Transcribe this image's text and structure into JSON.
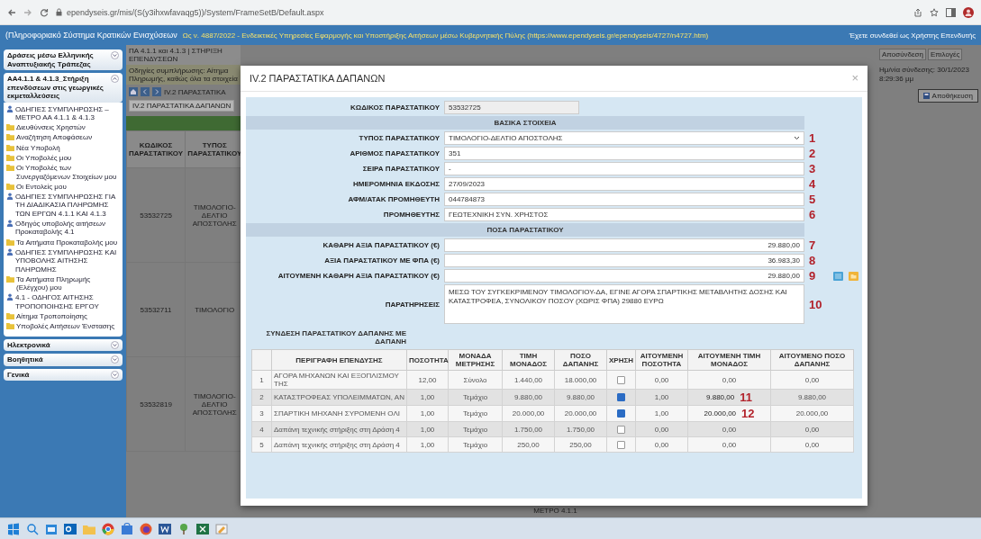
{
  "browser": {
    "url": "ependyseis.gr/mis/(S(y3ihxwfavaqg5))/System/FrameSetB/Default.aspx"
  },
  "header": {
    "title": "(Πληροφοριακό Σύστημα Κρατικών Ενισχύσεων",
    "notice": "Ως ν. 4887/2022 - Ενδεικτικές Υπηρεσίες Εφαρμογής και Υποστήριξης Αιτήσεων μέσω Κυβερνητικής Πύλης (https://www.ependyseis.gr/ependyseis/4727/n4727.htm)",
    "user_info": "Έχετε συνδεθεί ως Χρήστης Επενδυτής"
  },
  "sidebar": {
    "sections": [
      {
        "title": "Δράσεις μέσω Ελληνικής Αναπτυξιακής Τράπεζας",
        "expanded": false
      },
      {
        "title": "ΑΑ4.1.1 & 4.1.3_Στήριξη επενδύσεων στις γεωργικές εκμεταλλεύσεις",
        "expanded": true,
        "items": [
          {
            "kind": "guide",
            "label": "ΟΔΗΓΙΕΣ ΣΥΜΠΛΗΡΩΣΗΣ – ΜΕΤΡΟ ΑΑ 4.1.1 & 4.1.3"
          },
          {
            "kind": "folder",
            "label": "Διευθύνσεις Χρηστών"
          },
          {
            "kind": "folder",
            "label": "Αναζήτηση Αποφάσεων"
          },
          {
            "kind": "folder",
            "label": "Νέα Υποβολή"
          },
          {
            "kind": "folder",
            "label": "Οι Υποβολές μου"
          },
          {
            "kind": "folder",
            "label": "Οι Υποβολές των Συνεργαζόμενων Στοιχείων μου"
          },
          {
            "kind": "folder",
            "label": "Οι Εντολείς μου"
          },
          {
            "kind": "guide",
            "label": "ΟΔΗΓΙΕΣ ΣΥΜΠΛΗΡΩΣΗΣ ΓΙΑ ΤΗ ΔΙΑΔΙΚΑΣΙΑ ΠΛΗΡΩΜΗΣ ΤΩΝ ΕΡΓΩΝ 4.1.1 ΚΑΙ 4.1.3"
          },
          {
            "kind": "guide",
            "label": "Οδηγός υποβολής αιτήσεων Προκαταβολής 4.1"
          },
          {
            "kind": "folder",
            "label": "Τα Αιτήματα Προκαταβολής μου"
          },
          {
            "kind": "guide",
            "label": "ΟΔΗΓΙΕΣ ΣΥΜΠΛΗΡΩΣΗΣ ΚΑΙ ΥΠΟΒΟΛΗΣ ΑΙΤΗΣΗΣ ΠΛΗΡΩΜΗΣ"
          },
          {
            "kind": "folder",
            "label": "Τα Αιτήματα Πληρωμής (Ελέγχου) μου"
          },
          {
            "kind": "guide",
            "label": "4.1 - ΟΔΗΓΟΣ ΑΙΤΗΣΗΣ ΤΡΟΠΟΠΟΙΗΣΗΣ ΕΡΓΟΥ"
          },
          {
            "kind": "folder",
            "label": "Αίτημα Τροποποίησης"
          },
          {
            "kind": "folder",
            "label": "Υποβολές Αιτήσεων Ένστασης"
          }
        ]
      },
      {
        "title": "Ηλεκτρονικά",
        "expanded": false
      },
      {
        "title": "Βοηθητικά",
        "expanded": false
      },
      {
        "title": "Γενικά",
        "expanded": false
      }
    ]
  },
  "page": {
    "breadcrumb": "ΠΑ 4.1.1 και 4.1.3 | ΣΤΗΡΙΞΗ ΕΠΕΝΔΥΣΕΩΝ",
    "info": "Οδηγίες συμπλήρωσης: Αίτημα Πληρωμής, καθώς όλα τα στοιχεία",
    "tab": "IV.2 ΠΑΡΑΣΤΑΤΙΚΑ ΔΑΠΑΝΩΝ",
    "toolbar_title": "IV.2 ΠΑΡΑΣΤΑΤΙΚΑ",
    "columns": [
      "ΚΩΔΙΚΟΣ ΠΑΡΑΣΤΑΤΙΚΟΥ",
      "ΤΥΠΟΣ ΠΑΡΑΣΤΑΤΙΚΟΥ"
    ],
    "rows": [
      [
        "53532725",
        "ΤΙΜΟΛΟΓΙΟ-ΔΕΛΤΙΟ ΑΠΟΣΤΟΛΗΣ"
      ],
      [
        "53532711",
        "ΤΙΜΟΛΟΓΙΟ"
      ],
      [
        "53532819",
        "ΤΙΜΟΛΟΓΙΟ-ΔΕΛΤΙΟ ΑΠΟΣΤΟΛΗΣ"
      ]
    ],
    "top_buttons": [
      "Αποσύνδεση",
      "Επιλογές"
    ],
    "session": "Ημ/νία σύνδεσης: 30/1/2023 8:29:36 μμ",
    "save_button": "Αποθήκευση",
    "footer": "ΜΕΤΡΟ 4.1.1"
  },
  "modal": {
    "title": "IV.2 ΠΑΡΑΣΤΑΤΙΚΑ ΔΑΠΑΝΩΝ",
    "close": "×",
    "form": [
      {
        "kind": "readonly",
        "label": "ΚΩΔΙΚΟΣ ΠΑΡΑΣΤΑΤΙΚΟΥ",
        "value": "53532725"
      },
      {
        "kind": "section",
        "label": "ΒΑΣΙΚΑ ΣΤΟΙΧΕΙΑ"
      },
      {
        "kind": "select",
        "label": "ΤΥΠΟΣ ΠΑΡΑΣΤΑΤΙΚΟΥ",
        "value": "ΤΙΜΟΛΟΓΙΟ-ΔΕΛΤΙΟ ΑΠΟΣΤΟΛΗΣ",
        "annotation": "1"
      },
      {
        "kind": "text",
        "label": "ΑΡΙΘΜΟΣ ΠΑΡΑΣΤΑΤΙΚΟΥ",
        "value": "351",
        "annotation": "2"
      },
      {
        "kind": "text",
        "label": "ΣΕΙΡΑ ΠΑΡΑΣΤΑΤΙΚΟΥ",
        "value": "-",
        "annotation": "3"
      },
      {
        "kind": "text",
        "label": "ΗΜΕΡΟΜΗΝΙΑ ΕΚΔΟΣΗΣ",
        "value": "27/09/2023",
        "annotation": "4"
      },
      {
        "kind": "text",
        "label": "ΑΦΜ/ΑΤΑΚ ΠΡΟΜΗΘΕΥΤΗ",
        "value": "044784873",
        "annotation": "5"
      },
      {
        "kind": "text",
        "label": "ΠΡΟΜΗΘΕΥΤΗΣ",
        "value": "ΓΕΩΤΕΧΝΙΚΗ ΣΥΝ. ΧΡΗΣΤΟΣ",
        "annotation": "6"
      },
      {
        "kind": "section",
        "label": "ΠΟΣΑ ΠΑΡΑΣΤΑΤΙΚΟΥ"
      },
      {
        "kind": "amount",
        "label": "ΚΑΘΑΡΗ ΑΞΙΑ ΠΑΡΑΣΤΑΤΙΚΟΥ (€)",
        "value": "29.880,00",
        "annotation": "7"
      },
      {
        "kind": "amount",
        "label": "ΑΞΙΑ ΠΑΡΑΣΤΑΤΙΚΟΥ ΜΕ ΦΠΑ (€)",
        "value": "36.983,30",
        "annotation": "8"
      },
      {
        "kind": "amount",
        "label": "ΑΙΤΟΥΜΕΝΗ ΚΑΘΑΡΗ ΑΞΙΑ ΠΑΡΑΣΤΑΤΙΚΟΥ (€)",
        "value": "29.880,00",
        "annotation": "9",
        "tools": true
      },
      {
        "kind": "textarea",
        "label": "ΠΑΡΑΤΗΡΗΣΕΙΣ",
        "value": "ΜΕΣΩ ΤΟΥ ΣΥΓΚΕΚΡΙΜΕΝΟΥ ΤΙΜΟΛΟΓΙΟΥ-ΔΑ, ΕΓΙΝΕ ΑΓΟΡΑ ΣΠΑΡΤΙΚΗΣ ΜΕΤΑΒΛΗΤΗΣ ΔΟΣΗΣ ΚΑΙ ΚΑΤΑΣΤΡΟΦΕΑ, ΣΥΝΟΛΙΚΟΥ ΠΟΣΟΥ (ΧΩΡΙΣ ΦΠΑ) 29880 ΕΥΡΩ",
        "annotation": "10"
      }
    ],
    "table_title": "ΣΥΝΔΕΣΗ ΠΑΡΑΣΤΑΤΙΚΟΥ ΔΑΠΑΝΗΣ ΜΕ ΔΑΠΑΝΗ",
    "columns": [
      {
        "label": "ΠΕΡΙΓΡΑΦΗ ΕΠΕΝΔΥΣΗΣ",
        "kind": "text"
      },
      {
        "label": "ΠΟΣΟΤΗΤΑ",
        "kind": "text"
      },
      {
        "label": "ΜΟΝΑΔΑ ΜΕΤΡΗΣΗΣ",
        "kind": "text"
      },
      {
        "label": "ΤΙΜΗ ΜΟΝΑΔΟΣ",
        "kind": "text"
      },
      {
        "label": "ΠΟΣΟ ΔΑΠΑΝΗΣ",
        "kind": "text"
      },
      {
        "label": "ΧΡΗΣΗ",
        "kind": "check"
      },
      {
        "label": "ΑΙΤΟΥΜΕΝΗ ΠΟΣΟΤΗΤΑ",
        "kind": "text"
      },
      {
        "label": "ΑΙΤΟΥΜΕΝΗ ΤΙΜΗ ΜΟΝΑΔΟΣ",
        "kind": "text"
      },
      {
        "label": "ΑΙΤΟΥΜΕΝΟ ΠΟΣΟ ΔΑΠΑΝΗΣ",
        "kind": "text"
      }
    ],
    "rows": [
      {
        "number": "1",
        "cells": [
          "ΑΓΟΡΑ ΜΗΧΑΝΩΝ ΚΑΙ ΕΞΟΠΛΙΣΜΟΥ ΤΗΣ",
          "12,00",
          "Σύνολο",
          "1.440,00",
          "18.000,00",
          "",
          "0,00",
          "0,00",
          "0,00"
        ],
        "used": false
      },
      {
        "number": "2",
        "cells": [
          "ΚΑΤΑΣΤΡΟΦΕΑΣ ΥΠΟΛΕΙΜΜΑΤΩΝ, ΑΝ",
          "1,00",
          "Τεμάχιο",
          "9.880,00",
          "9.880,00",
          "",
          "1,00",
          "9.880,00",
          "9.880,00"
        ],
        "used": true,
        "annotation": "11"
      },
      {
        "number": "3",
        "cells": [
          "ΣΠΑΡΤΙΚΗ ΜΗΧΑΝΗ ΣΥΡΟΜΕΝΗ ΟΛΙ",
          "1,00",
          "Τεμάχιο",
          "20.000,00",
          "20.000,00",
          "",
          "1,00",
          "20.000,00",
          "20.000,00"
        ],
        "used": true,
        "annotation": "12"
      },
      {
        "number": "4",
        "cells": [
          "Δαπάνη τεχνικής στήριξης στη Δράση 4",
          "1,00",
          "Τεμάχιο",
          "1.750,00",
          "1.750,00",
          "",
          "0,00",
          "0,00",
          "0,00"
        ],
        "used": false
      },
      {
        "number": "5",
        "cells": [
          "Δαπάνη τεχνικής στήριξης στη Δράση 4",
          "1,00",
          "Τεμάχιο",
          "250,00",
          "250,00",
          "",
          "0,00",
          "0,00",
          "0,00"
        ],
        "used": false
      }
    ]
  },
  "taskbar": {
    "apps": [
      {
        "kind": "start"
      },
      {
        "kind": "search"
      },
      {
        "kind": "files"
      },
      {
        "kind": "outlook"
      },
      {
        "kind": "folder"
      },
      {
        "kind": "chrome"
      },
      {
        "kind": "store"
      },
      {
        "kind": "firefox"
      },
      {
        "kind": "word"
      },
      {
        "kind": "tree"
      },
      {
        "kind": "excel"
      },
      {
        "kind": "paint"
      }
    ]
  }
}
